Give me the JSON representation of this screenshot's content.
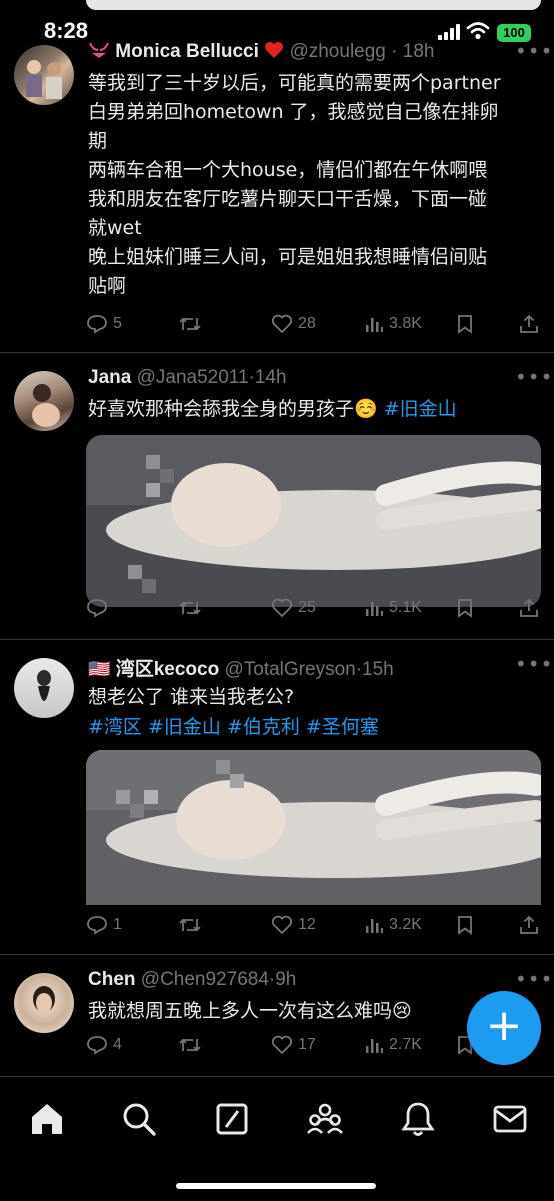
{
  "status": {
    "time": "8:28",
    "battery": "100"
  },
  "tweets": [
    {
      "name": "Monica Bellucci",
      "handle": "@zhoulegg",
      "dot": "·",
      "time": "18h",
      "lines": [
        "等我到了三十岁以后，可能真的需要两个partner",
        "白男弟弟回hometown 了，我感觉自己像在排卵",
        "期",
        "两辆车合租一个大house，情侣们都在午休啊喂",
        "我和朋友在客厅吃薯片聊天口干舌燥，下面一碰",
        "就wet",
        "晚上姐妹们睡三人间，可是姐姐我想睡情侣间贴",
        "贴啊"
      ],
      "replies": "5",
      "likes": "28",
      "views": "3.8K"
    },
    {
      "name": "Jana",
      "handle": "@Jana52011",
      "dot": "·",
      "time": "14h",
      "text": "好喜欢那种会舔我全身的男孩子☺️",
      "hashtag": "#旧金山",
      "replies": "",
      "likes": "25",
      "views": "5.1K"
    },
    {
      "flag": "🇺🇸",
      "name": "湾区kecoco",
      "handle": "@TotalGreyson",
      "dot": "·",
      "time": "15h",
      "text": "想老公了 谁来当我老公?",
      "hashtags": [
        "#湾区",
        "#旧金山",
        "#伯克利",
        "#圣何塞"
      ],
      "replies": "1",
      "likes": "12",
      "views": "3.2K"
    },
    {
      "name": "Chen",
      "handle": "@Chen927684",
      "dot": "·",
      "time": "9h",
      "text": "我就想周五晚上多人一次有这么难吗😢",
      "replies": "4",
      "likes": "17",
      "views": "2.7K"
    }
  ],
  "more_glyph": "•••",
  "fab_label": "+",
  "colors": {
    "accent": "#1d9bf0",
    "text": "#e7e9ea",
    "muted": "#71767b",
    "divider": "#2f3336",
    "battery": "#30d158"
  }
}
